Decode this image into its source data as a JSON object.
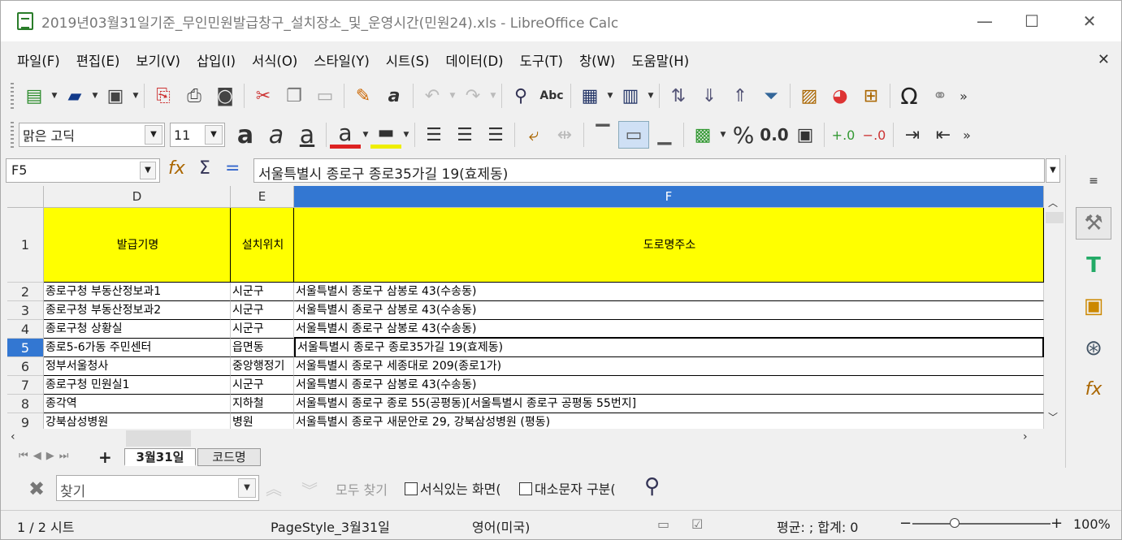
{
  "window": {
    "title": "2019년03월31일기준_무인민원발급창구_설치장소_및_운영시간(민원24).xls - LibreOffice Calc"
  },
  "menu": [
    "파일(F)",
    "편집(E)",
    "보기(V)",
    "삽입(I)",
    "서식(O)",
    "스타일(Y)",
    "시트(S)",
    "데이터(D)",
    "도구(T)",
    "창(W)",
    "도움말(H)"
  ],
  "format_toolbar": {
    "font_name": "맑은 고딕",
    "font_size": "11",
    "percent": "%",
    "decimal": "0.0"
  },
  "formula_bar": {
    "cell_ref": "F5",
    "content": "서울특별시 종로구 종로35가길 19(효제동)"
  },
  "columns": {
    "d": "D",
    "e": "E",
    "f": "F"
  },
  "rows": [
    {
      "num": "1",
      "d": "발급기명",
      "e": "설치위치",
      "f": "도로명주소"
    },
    {
      "num": "2",
      "d": "종로구청 부동산정보과1",
      "e": "시군구",
      "f": "서울특별시 종로구 삼봉로 43(수송동)"
    },
    {
      "num": "3",
      "d": "종로구청 부동산정보과2",
      "e": "시군구",
      "f": "서울특별시 종로구 삼봉로 43(수송동)"
    },
    {
      "num": "4",
      "d": "종로구청 상황실",
      "e": "시군구",
      "f": "서울특별시 종로구 삼봉로 43(수송동)"
    },
    {
      "num": "5",
      "d": "종로5-6가동 주민센터",
      "e": "읍면동",
      "f": "서울특별시 종로구 종로35가길 19(효제동)"
    },
    {
      "num": "6",
      "d": "정부서울청사",
      "e": "중앙행정기",
      "f": "서울특별시 종로구 세종대로 209(종로1가)"
    },
    {
      "num": "7",
      "d": "종로구청 민원실1",
      "e": "시군구",
      "f": "서울특별시 종로구 삼봉로 43(수송동)"
    },
    {
      "num": "8",
      "d": "종각역",
      "e": "지하철",
      "f": "서울특별시 종로구 종로 55(공평동)[서울특별시 종로구 공평동 55번지]"
    },
    {
      "num": "9",
      "d": "강북삼성병원",
      "e": "병원",
      "f": "서울특별시 종로구 새문안로 29, 강북삼성병원 (평동)"
    }
  ],
  "sheet_tabs": [
    "3월31일",
    "코드명"
  ],
  "find_bar": {
    "placeholder": "찾기",
    "find_all": "모두 찾기",
    "formatted": "서식있는 화면(",
    "match_case": "대소문자 구분("
  },
  "status": {
    "sheet": "1 / 2 시트",
    "page_style": "PageStyle_3월31일",
    "language": "영어(미국)",
    "summary": "평균: ; 합계: 0",
    "zoom": "100%"
  },
  "colors": {
    "accent": "#3377d2",
    "header_fill": "#ffff00"
  }
}
